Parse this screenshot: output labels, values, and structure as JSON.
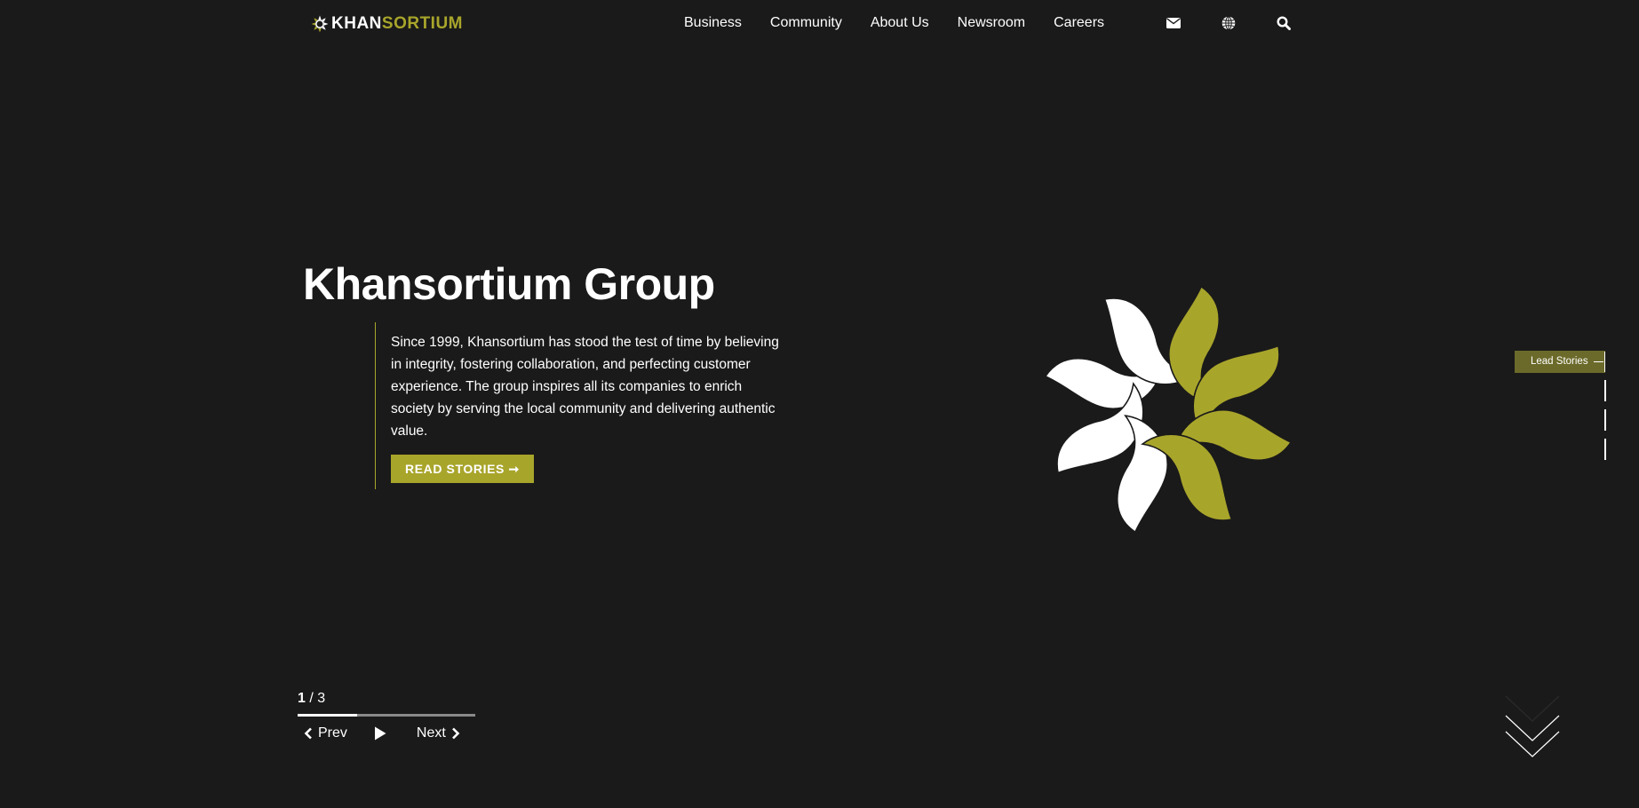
{
  "brand": {
    "logo_part1": "KHAN",
    "logo_part2": "SORTIUM",
    "accent_color": "#a8a52b",
    "background_color": "#1a1a1a"
  },
  "nav": {
    "items": [
      {
        "label": "Business"
      },
      {
        "label": "Community"
      },
      {
        "label": "About Us"
      },
      {
        "label": "Newsroom"
      },
      {
        "label": "Careers"
      }
    ]
  },
  "utility": {
    "icons": [
      "envelope-icon",
      "globe-icon",
      "search-icon"
    ]
  },
  "hero": {
    "title": "Khansortium Group",
    "description": "Since 1999, Khansortium has stood the test of time by believing in integrity, fostering collaboration, and perfecting customer experience. The group inspires all its companies to enrich society by serving the local community and delivering authentic value.",
    "cta_label": "READ STORIES ➞"
  },
  "side_pager": {
    "active_label": "Lead Stories",
    "total_items": 4
  },
  "slider": {
    "current": "1",
    "total": "/ 3",
    "progress_fraction": 0.333,
    "prev_label": "Prev",
    "next_label": "Next"
  }
}
